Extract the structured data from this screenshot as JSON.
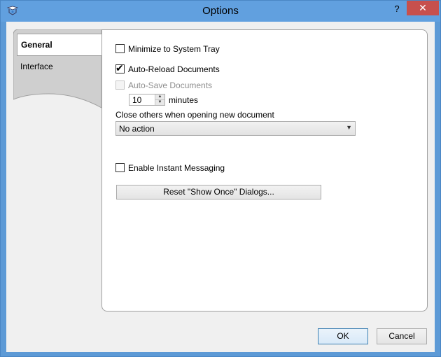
{
  "window": {
    "title": "Options",
    "help_label": "?",
    "close_label": "✕"
  },
  "tabs": [
    {
      "label": "General",
      "selected": true
    },
    {
      "label": "Interface",
      "selected": false
    }
  ],
  "general": {
    "minimize_to_tray": {
      "label": "Minimize to System Tray",
      "checked": false
    },
    "auto_reload": {
      "label": "Auto-Reload Documents",
      "checked": true
    },
    "auto_save": {
      "label": "Auto-Save Documents",
      "checked": false,
      "enabled": false
    },
    "auto_save_interval": {
      "value": "10",
      "unit": "minutes"
    },
    "close_others_label": "Close others when opening new document",
    "close_others_select": {
      "value": "No action"
    },
    "instant_messaging": {
      "label": "Enable Instant Messaging",
      "checked": false
    },
    "reset_dialogs_button": "Reset \"Show Once\" Dialogs..."
  },
  "footer": {
    "ok_label": "OK",
    "cancel_label": "Cancel"
  },
  "colors": {
    "titlebar": "#61a0df",
    "close_button": "#c7504d",
    "dialog_bg": "#f0f0f0"
  }
}
